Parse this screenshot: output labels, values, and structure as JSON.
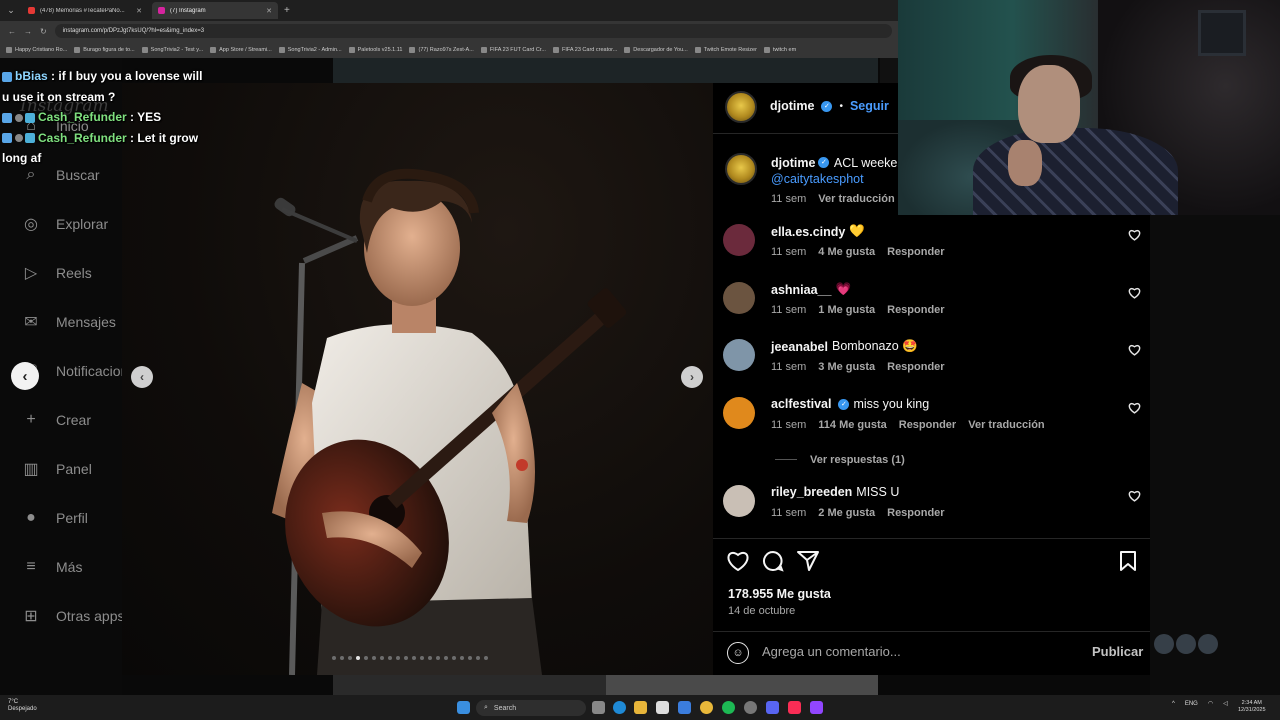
{
  "browser": {
    "tabs": [
      {
        "title": "(478) Memorias #TecatePaNo...",
        "color": "#e53935"
      },
      {
        "title": "(7) Instagram",
        "color": "#d6249f"
      }
    ],
    "url": "instagram.com/p/DPzJgt7ksUQ/?hl=es&img_index=3",
    "bookmarks": [
      "Happy Cristiano Ro...",
      "Burago figura de to...",
      "SongTrivia2 - Test y...",
      "App Store / Streami...",
      "SongTrivia2 - Admin...",
      "Paletools v25.1.11",
      "(77) Razo97s Zest-A...",
      "FIFA 23 FUT Card Cr...",
      "FIFA 23 Card creator...",
      "Descargador de You...",
      "Twitch Emote Resizer",
      "twitch em"
    ]
  },
  "chat": [
    {
      "user": "bBias",
      "text": ": if I buy you a lovense will u use it on stream ?"
    },
    {
      "user": "Cash_Refunder",
      "text": ": YES"
    },
    {
      "user": "Cash_Refunder",
      "text": ": Let it grow long af"
    }
  ],
  "sidebar": {
    "logo": "Instagram",
    "items": [
      {
        "label": "Inicio",
        "icon": "home-icon",
        "glyph": "⌂"
      },
      {
        "label": "Buscar",
        "icon": "search-icon",
        "glyph": "⌕"
      },
      {
        "label": "Explorar",
        "icon": "compass-icon",
        "glyph": "◎"
      },
      {
        "label": "Reels",
        "icon": "reels-icon",
        "glyph": "▷"
      },
      {
        "label": "Mensajes",
        "icon": "messenger-icon",
        "glyph": "✉"
      },
      {
        "label": "Notificaciones",
        "icon": "heart-icon",
        "glyph": "♡"
      },
      {
        "label": "Crear",
        "icon": "plus-icon",
        "glyph": "+"
      },
      {
        "label": "Panel",
        "icon": "chart-icon",
        "glyph": "▥"
      },
      {
        "label": "Perfil",
        "icon": "avatar-icon",
        "glyph": "●"
      },
      {
        "label": "Más",
        "icon": "menu-icon",
        "glyph": "≡"
      },
      {
        "label": "Otras apps",
        "icon": "apps-icon",
        "glyph": "⊞"
      }
    ]
  },
  "post": {
    "author": "djotime",
    "follow": "Seguir",
    "caption": "ACL weekend Austin",
    "caption_mention": "@caitytakesphot",
    "caption_age": "11 sem",
    "caption_translate": "Ver traducción",
    "carousel_dots": 20,
    "carousel_active": 3,
    "likes": "178.955 Me gusta",
    "date": "14 de octubre",
    "comment_placeholder": "Agrega un comentario...",
    "publish": "Publicar"
  },
  "comments": [
    {
      "user": "ella.es.cindy",
      "text": "💛",
      "age": "11 sem",
      "likes": "4 Me gusta",
      "reply": "Responder",
      "verified": false,
      "avatar_color": "#6b2a3c"
    },
    {
      "user": "ashniaa__",
      "text": "💗",
      "age": "11 sem",
      "likes": "1 Me gusta",
      "reply": "Responder",
      "verified": false,
      "avatar_color": "#6b5440"
    },
    {
      "user": "jeeanabel",
      "text": "Bombonazo 🤩",
      "age": "11 sem",
      "likes": "3 Me gusta",
      "reply": "Responder",
      "verified": false,
      "avatar_color": "#7f95a8"
    },
    {
      "user": "aclfestival",
      "text": "miss you king",
      "age": "11 sem",
      "likes": "114 Me gusta",
      "reply": "Responder",
      "translate": "Ver traducción",
      "verified": true,
      "avatar_color": "#e0891c"
    },
    {
      "user": "riley_breeden",
      "text": "MISS U",
      "age": "11 sem",
      "likes": "2 Me gusta",
      "reply": "Responder",
      "verified": false,
      "avatar_color": "#c9bfb5"
    }
  ],
  "view_replies": "Ver respuestas (1)",
  "taskbar": {
    "weather_temp": "7°C",
    "weather_desc": "Despejado",
    "search": "Search",
    "lang": "ENG",
    "time": "2:34 AM",
    "date": "12/31/2025"
  }
}
